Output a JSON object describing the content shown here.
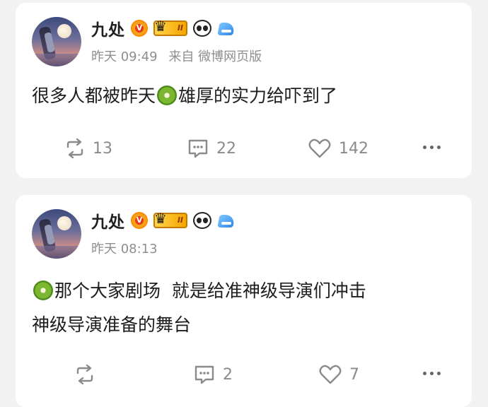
{
  "posts": [
    {
      "author": "九处",
      "time": "昨天 09:49",
      "source": "来自 微博网页版",
      "text_before": "很多人都被昨天",
      "text_after": "雄厚的实力给吓到了",
      "actions": {
        "repost": "13",
        "comment": "22",
        "like": "142"
      }
    },
    {
      "author": "九处",
      "time": "昨天 08:13",
      "source": "",
      "text_line1": "那个大家剧场  就是给准神级导演们冲击",
      "text_line2": "神级导演准备的舞台",
      "actions": {
        "repost": "",
        "comment": "2",
        "like": "7"
      }
    }
  ],
  "badges": {
    "verified_letter": "V",
    "level_roman": "II"
  },
  "icons": {
    "repost": "repost-icon",
    "comment": "comment-icon",
    "like": "heart-icon",
    "more": "more-dots-icon",
    "emoji": "kiwi-emoji"
  },
  "colors": {
    "background": "#f2f2f2",
    "card": "#ffffff",
    "text": "#1d1d1d",
    "meta": "#8e8e8e",
    "icon": "#8a8a8a",
    "verified": "#f7a11a"
  }
}
